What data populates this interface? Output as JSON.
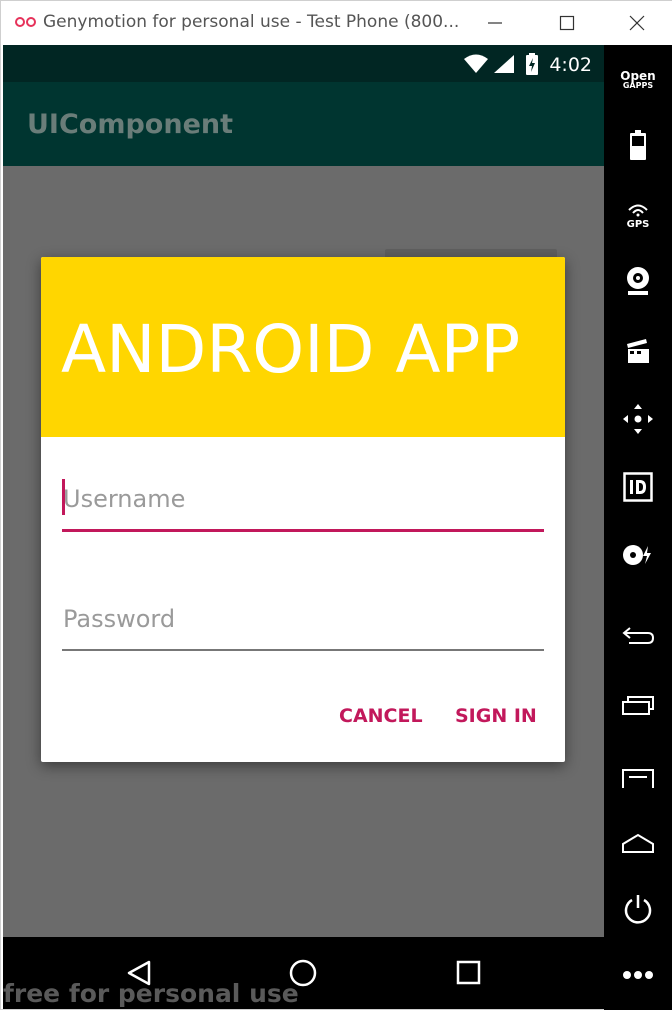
{
  "window": {
    "title": "Genymotion for personal use - Test Phone (800..."
  },
  "status_bar": {
    "time": "4:02"
  },
  "app": {
    "toolbar_title": "UIComponent"
  },
  "dialog": {
    "title": "ANDROID APP",
    "username_placeholder": "Username",
    "password_placeholder": "Password",
    "cancel_label": "CANCEL",
    "signin_label": "SIGN IN"
  },
  "sidebar": {
    "opengapps_line1": "Open",
    "opengapps_line2": "GAPPS",
    "gps_label": "GPS"
  },
  "watermark": "free for personal use",
  "colors": {
    "accent": "#c2185b",
    "header_yellow": "#ffd600",
    "toolbar": "#003530",
    "status_bar": "#012623"
  },
  "icons": [
    "genymotion-logo-icon",
    "minimize-icon",
    "maximize-icon",
    "close-icon",
    "wifi-icon",
    "signal-icon",
    "battery-icon",
    "battery-widget-icon",
    "gps-icon",
    "webcam-icon",
    "clapperboard-icon",
    "dpad-icon",
    "id-icon",
    "disk-icon",
    "back-icon",
    "recent-apps-icon",
    "menu-icon",
    "home-icon",
    "power-icon",
    "more-icon"
  ]
}
